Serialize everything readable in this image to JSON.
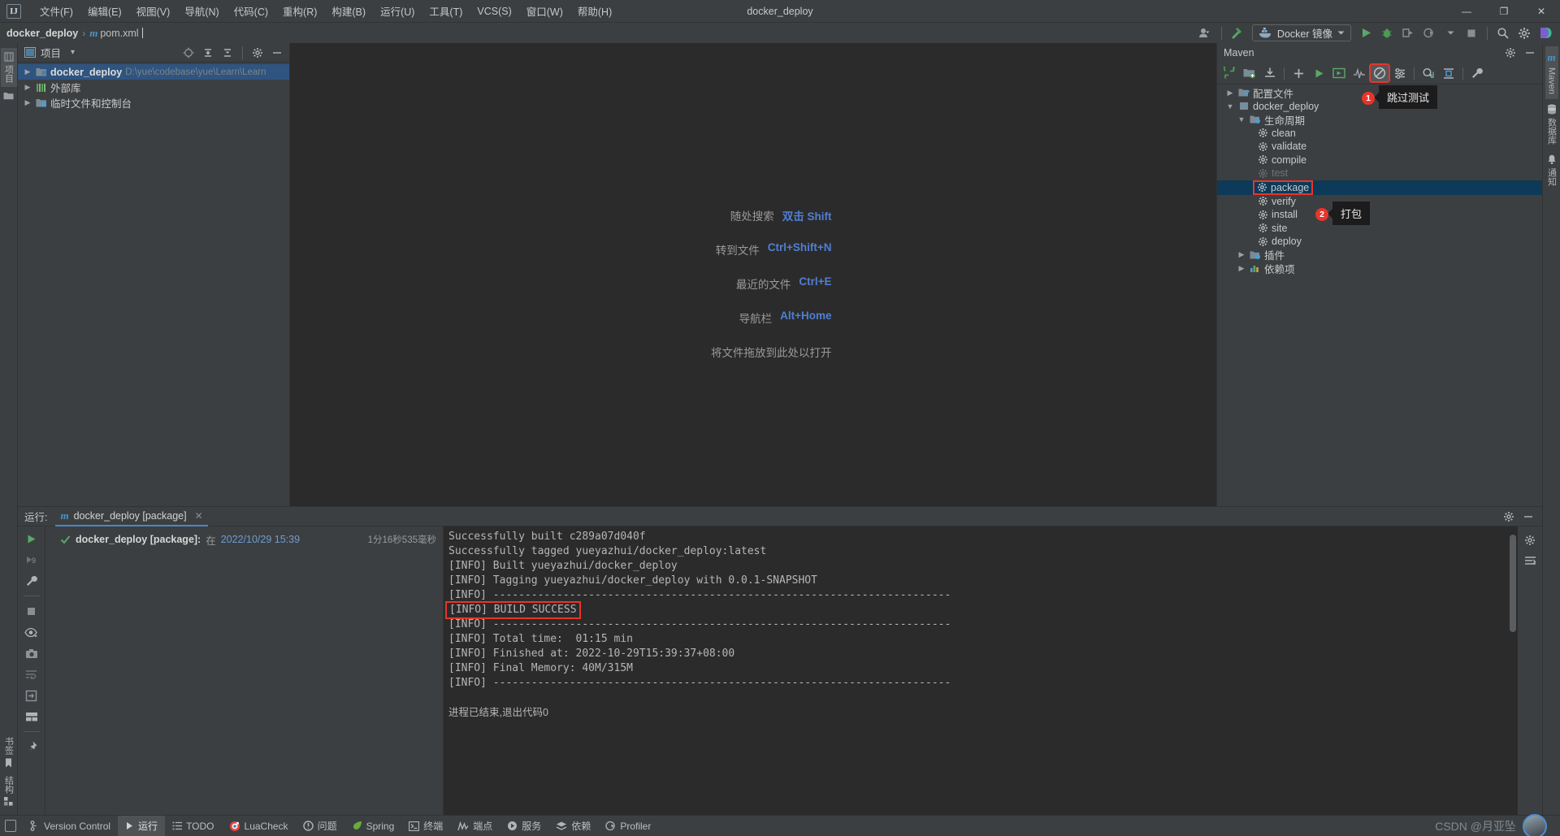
{
  "window": {
    "title": "docker_deploy",
    "logo": "IJ",
    "controls": {
      "minimize": "—",
      "maximize": "❐",
      "close": "✕"
    }
  },
  "menu": [
    {
      "label": "文件(F)"
    },
    {
      "label": "编辑(E)"
    },
    {
      "label": "视图(V)"
    },
    {
      "label": "导航(N)"
    },
    {
      "label": "代码(C)"
    },
    {
      "label": "重构(R)"
    },
    {
      "label": "构建(B)"
    },
    {
      "label": "运行(U)"
    },
    {
      "label": "工具(T)"
    },
    {
      "label": "VCS(S)"
    },
    {
      "label": "窗口(W)"
    },
    {
      "label": "帮助(H)"
    }
  ],
  "breadcrumb": {
    "project": "docker_deploy",
    "separator": "›",
    "file_icon": "m",
    "file": "pom.xml"
  },
  "toolbar": {
    "run_config": "Docker 镜像",
    "icons": [
      "user-avatar-icon",
      "hammer-build-icon",
      "docker-whale-icon",
      "run-icon",
      "debug-icon",
      "run-with-coverage-icon",
      "profile-icon",
      "stop-icon",
      "search-everywhere-icon",
      "settings-icon",
      "ide-assistant-icon"
    ]
  },
  "left_strip": {
    "tabs": [
      {
        "label": "项目",
        "icon": "project-icon",
        "selected": true
      },
      {
        "label": "",
        "icon": "folder-icon",
        "selected": false
      }
    ],
    "bottom_tabs": [
      {
        "label": "书签",
        "icon": "bookmark-icon"
      },
      {
        "label": "结构",
        "icon": "structure-icon"
      }
    ]
  },
  "project_panel": {
    "title": "项目",
    "dropdown": "▾",
    "head_icons": [
      "locate-icon",
      "expand-all-icon",
      "collapse-all-icon",
      "gear-icon",
      "hide-icon"
    ],
    "tree": [
      {
        "label": "docker_deploy",
        "path": "D:\\yue\\codebase\\yue\\Learn\\Learn",
        "icon": "module-icon",
        "expanded": false,
        "selected": true,
        "indent": 0
      },
      {
        "label": "外部库",
        "path": "",
        "icon": "library-icon",
        "expanded": false,
        "selected": false,
        "indent": 0
      },
      {
        "label": "临时文件和控制台",
        "path": "",
        "icon": "scratches-icon",
        "expanded": false,
        "selected": false,
        "indent": 0
      }
    ]
  },
  "editor": {
    "hints": [
      {
        "label": "随处搜索",
        "key": "双击 Shift"
      },
      {
        "label": "转到文件",
        "key": "Ctrl+Shift+N"
      },
      {
        "label": "最近的文件",
        "key": "Ctrl+E"
      },
      {
        "label": "导航栏",
        "key": "Alt+Home"
      }
    ],
    "drop_hint": "将文件拖放到此处以打开"
  },
  "maven_panel": {
    "title": "Maven",
    "toolbar_icons": [
      "refresh-icon",
      "add-module-icon",
      "download-sources-icon",
      "add-icon",
      "run-icon",
      "execute-goal-icon",
      "toggle-offline-icon",
      "skip-tests-icon",
      "filter-icon",
      "analyze-dependencies-icon",
      "show-diagram-icon",
      "settings-wrench-icon"
    ],
    "head_icons": [
      "gear-icon",
      "hide-icon"
    ],
    "tree": [
      {
        "label": "配置文件",
        "icon": "profiles-icon",
        "indent": 0,
        "arrow": "right",
        "state": "normal"
      },
      {
        "label": "docker_deploy",
        "icon": "maven-project-icon",
        "indent": 0,
        "arrow": "down",
        "state": "normal"
      },
      {
        "label": "生命周期",
        "icon": "lifecycle-icon",
        "indent": 1,
        "arrow": "down",
        "state": "normal"
      },
      {
        "label": "clean",
        "icon": "goal-icon",
        "indent": 2,
        "arrow": "none",
        "state": "normal"
      },
      {
        "label": "validate",
        "icon": "goal-icon",
        "indent": 2,
        "arrow": "none",
        "state": "normal"
      },
      {
        "label": "compile",
        "icon": "goal-icon",
        "indent": 2,
        "arrow": "none",
        "state": "normal"
      },
      {
        "label": "test",
        "icon": "goal-icon",
        "indent": 2,
        "arrow": "none",
        "state": "dim"
      },
      {
        "label": "package",
        "icon": "goal-icon",
        "indent": 2,
        "arrow": "none",
        "state": "selected-boxed"
      },
      {
        "label": "verify",
        "icon": "goal-icon",
        "indent": 2,
        "arrow": "none",
        "state": "normal"
      },
      {
        "label": "install",
        "icon": "goal-icon",
        "indent": 2,
        "arrow": "none",
        "state": "normal"
      },
      {
        "label": "site",
        "icon": "goal-icon",
        "indent": 2,
        "arrow": "none",
        "state": "normal"
      },
      {
        "label": "deploy",
        "icon": "goal-icon",
        "indent": 2,
        "arrow": "none",
        "state": "normal"
      },
      {
        "label": "插件",
        "icon": "plugins-icon",
        "indent": 1,
        "arrow": "right",
        "state": "normal"
      },
      {
        "label": "依赖项",
        "icon": "dependencies-icon",
        "indent": 1,
        "arrow": "right",
        "state": "normal"
      }
    ]
  },
  "annotations": [
    {
      "number": "1",
      "tooltip": "跳过测试"
    },
    {
      "number": "2",
      "tooltip": "打包"
    }
  ],
  "right_strip": {
    "tabs": [
      {
        "label": "Maven",
        "icon": "maven-icon",
        "selected": true
      },
      {
        "label": "数据库",
        "icon": "database-icon",
        "selected": false
      },
      {
        "label": "通知",
        "icon": "bell-icon",
        "selected": false
      }
    ]
  },
  "run_window": {
    "head_label": "运行:",
    "tab": {
      "icon": "m",
      "label": "docker_deploy [package]",
      "close": "✕"
    },
    "head_right_icons": [
      "settings-icon",
      "hide-icon"
    ],
    "left_tool_icons": [
      "rerun-icon",
      "rerun-failed-icon",
      "wrench-icon",
      "stop-icon",
      "eye-filter-icon",
      "screenshot-icon",
      "soft-wrap-icon",
      "scroll-to-end-icon",
      "layout-icon",
      "pin-icon"
    ],
    "right_tool_icons": [
      "settings-icon",
      "export-icon"
    ],
    "tree": {
      "status_icon": "check-icon",
      "name": "docker_deploy [package]:",
      "when_label": "在",
      "date": "2022/10/29 15:39",
      "duration": "1分16秒535毫秒"
    },
    "console_lines": [
      {
        "text": "Successfully built c289a07d040f",
        "style": "normal"
      },
      {
        "text": "Successfully tagged yueyazhui/docker_deploy:latest",
        "style": "normal"
      },
      {
        "text": "[INFO] Built yueyazhui/docker_deploy",
        "style": "normal"
      },
      {
        "text": "[INFO] Tagging yueyazhui/docker_deploy with 0.0.1-SNAPSHOT",
        "style": "normal"
      },
      {
        "text": "[INFO] ------------------------------------------------------------------------",
        "style": "normal"
      },
      {
        "text": "[INFO] BUILD SUCCESS",
        "style": "boxed"
      },
      {
        "text": "[INFO] ------------------------------------------------------------------------",
        "style": "normal"
      },
      {
        "text": "[INFO] Total time:  01:15 min",
        "style": "normal"
      },
      {
        "text": "[INFO] Finished at: 2022-10-29T15:39:37+08:00",
        "style": "normal"
      },
      {
        "text": "[INFO] Final Memory: 40M/315M",
        "style": "normal"
      },
      {
        "text": "[INFO] ------------------------------------------------------------------------",
        "style": "normal"
      },
      {
        "text": "",
        "style": "normal"
      },
      {
        "text": "进程已结束,退出代码0",
        "style": "zh"
      }
    ]
  },
  "statusbar": {
    "items": [
      {
        "label": "Version Control",
        "icon": "branch-icon",
        "active": false
      },
      {
        "label": "运行",
        "icon": "run-icon",
        "active": true
      },
      {
        "label": "TODO",
        "icon": "todo-icon",
        "active": false
      },
      {
        "label": "LuaCheck",
        "icon": "luacheck-icon",
        "active": false
      },
      {
        "label": "问题",
        "icon": "problems-icon",
        "active": false
      },
      {
        "label": "Spring",
        "icon": "spring-leaf-icon",
        "active": false
      },
      {
        "label": "终端",
        "icon": "terminal-icon",
        "active": false
      },
      {
        "label": "端点",
        "icon": "endpoints-icon",
        "active": false
      },
      {
        "label": "服务",
        "icon": "services-icon",
        "active": false
      },
      {
        "label": "依赖",
        "icon": "dependencies-icon",
        "active": false
      },
      {
        "label": "Profiler",
        "icon": "profiler-icon",
        "active": false
      }
    ],
    "watermark": "CSDN @月亚坠"
  },
  "colors": {
    "accent_blue": "#4a88c7",
    "selection_blue": "#2f5480",
    "maven_selection": "#0d3a58",
    "annotation_red": "#e8342a",
    "panel_bg": "#3c3f41",
    "editor_bg": "#2b2b2b",
    "green_run": "#59a869"
  }
}
